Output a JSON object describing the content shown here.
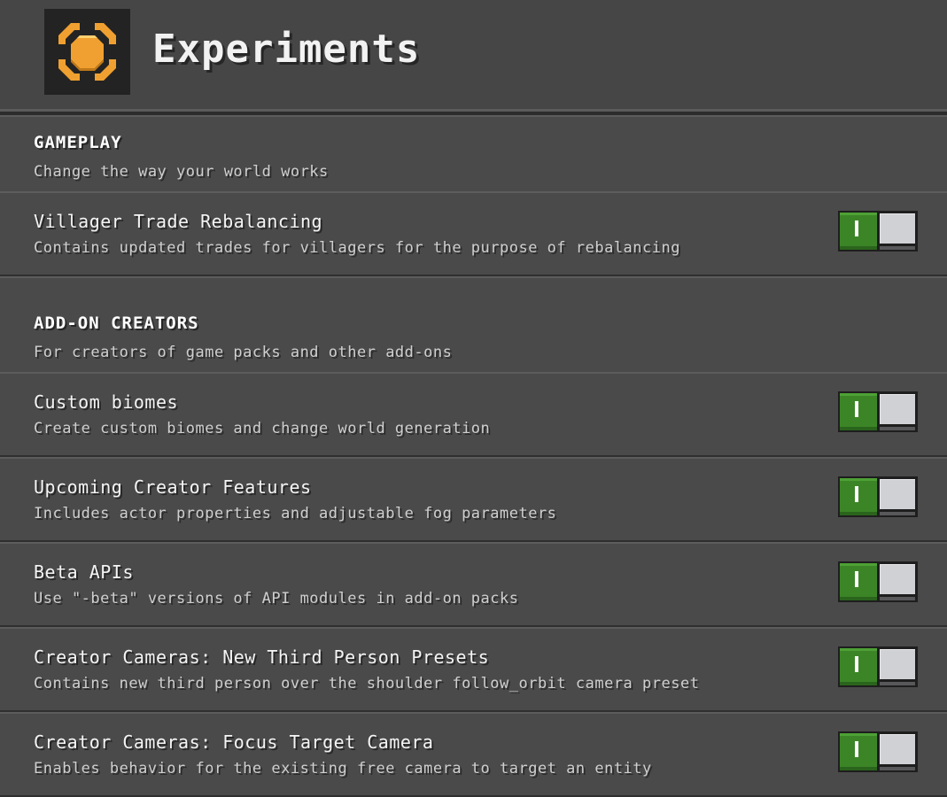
{
  "header": {
    "title": "Experiments",
    "icon": "experiments-icon"
  },
  "sections": [
    {
      "title": "GAMEPLAY",
      "description": "Change the way your world works",
      "items": [
        {
          "title": "Villager Trade Rebalancing",
          "description": "Contains updated trades for villagers for the purpose of rebalancing",
          "enabled": true
        }
      ]
    },
    {
      "title": "ADD-ON CREATORS",
      "description": "For creators of game packs and other add-ons",
      "items": [
        {
          "title": "Custom biomes",
          "description": "Create custom biomes and change world generation",
          "enabled": true
        },
        {
          "title": "Upcoming Creator Features",
          "description": "Includes actor properties and adjustable fog parameters",
          "enabled": true
        },
        {
          "title": "Beta APIs",
          "description": "Use \"-beta\" versions of API modules in add-on packs",
          "enabled": true
        },
        {
          "title": "Creator Cameras: New Third Person Presets",
          "description": "Contains new third person over the shoulder follow_orbit camera preset",
          "enabled": true
        },
        {
          "title": "Creator Cameras: Focus Target Camera",
          "description": "Enables behavior for the existing free camera to target an entity",
          "enabled": true
        }
      ]
    }
  ],
  "colors": {
    "toggle_on": "#3c8527",
    "background": "#4a4a4a",
    "header": "#464646",
    "logo_orange": "#f0a030"
  }
}
